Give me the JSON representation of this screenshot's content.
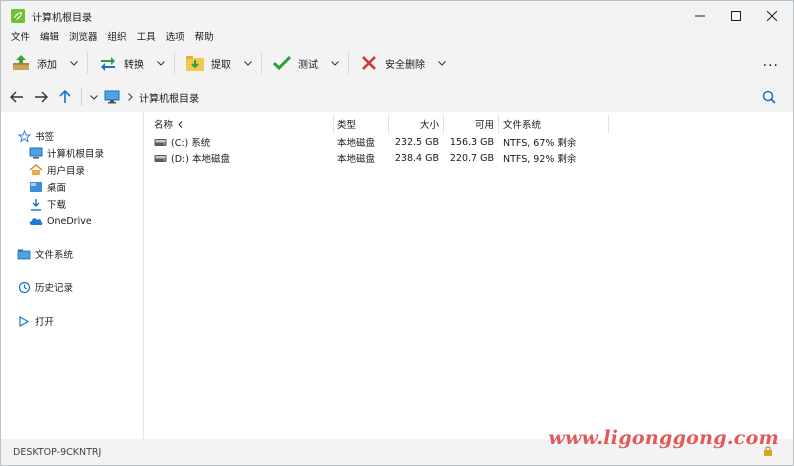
{
  "window": {
    "title": "计算机根目录"
  },
  "menu": [
    "文件",
    "编辑",
    "浏览器",
    "组织",
    "工具",
    "选项",
    "帮助"
  ],
  "toolbar": {
    "add": "添加",
    "convert": "转换",
    "extract": "提取",
    "test": "测试",
    "secure_delete": "安全删除",
    "more": "..."
  },
  "address": {
    "crumb": "计算机根目录"
  },
  "sidebar": {
    "bookmarks": "书签",
    "bookmark_items": [
      "计算机根目录",
      "用户目录",
      "桌面",
      "下载",
      "OneDrive"
    ],
    "filesystem": "文件系统",
    "history": "历史记录",
    "open": "打开"
  },
  "columns": {
    "name": "名称",
    "type": "类型",
    "size": "大小",
    "free": "可用",
    "fs": "文件系统"
  },
  "rows": [
    {
      "name": "(C:) 系统",
      "type": "本地磁盘",
      "size": "232.5 GB",
      "free": "156.3 GB",
      "fs": "NTFS, 67% 剩余"
    },
    {
      "name": "(D:) 本地磁盘",
      "type": "本地磁盘",
      "size": "238.4 GB",
      "free": "220.7 GB",
      "fs": "NTFS, 92% 剩余"
    }
  ],
  "status": {
    "computer": "DESKTOP-9CKNTRJ"
  },
  "watermark": "www.ligonggong.com",
  "colors": {
    "accent": "#1a73c9",
    "title_bg": "#f3f3f3",
    "content_bg": "#ffffff",
    "watermark": "#e05a5a"
  }
}
